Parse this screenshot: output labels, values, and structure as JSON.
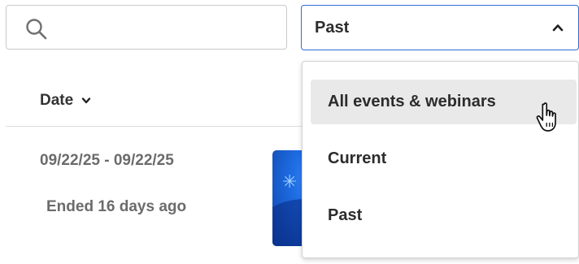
{
  "search": {
    "value": "",
    "placeholder": "",
    "icon": "search-icon"
  },
  "filter": {
    "selected_value": "Past",
    "icon": "chevron-up-icon",
    "accent_color": "#2f6ed8",
    "options": [
      {
        "label": "All events & webinars",
        "hovered": true
      },
      {
        "label": "Current",
        "hovered": false
      },
      {
        "label": "Past",
        "hovered": false
      }
    ]
  },
  "table": {
    "date_header": "Date",
    "sort_icon": "chevron-down-icon"
  },
  "event": {
    "dates": "09/22/25 - 09/22/25",
    "status": "Ended 16 days ago"
  },
  "cursor": {
    "icon": "hand-cursor-icon"
  }
}
